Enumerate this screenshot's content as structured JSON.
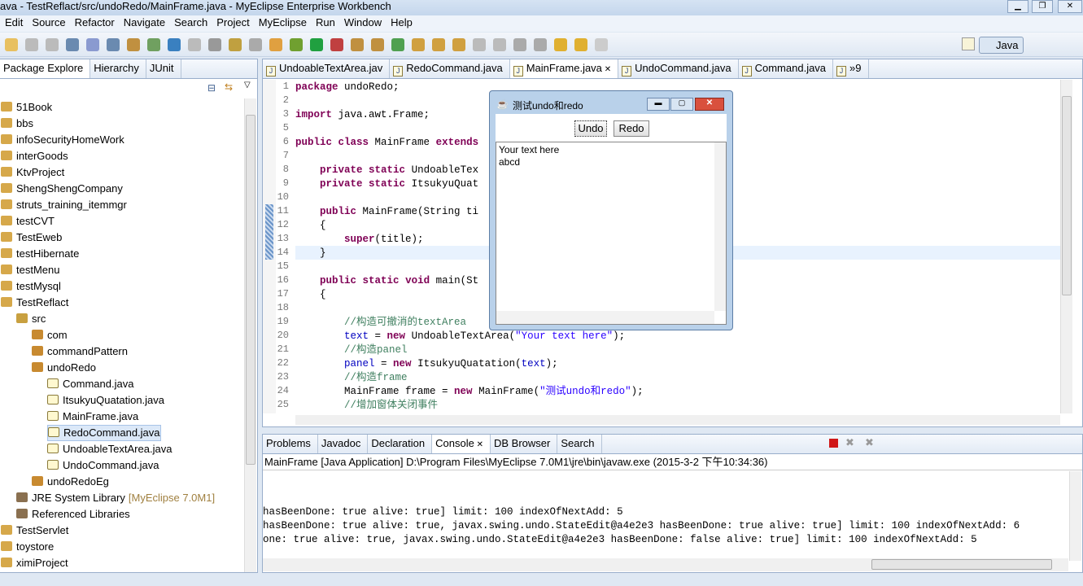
{
  "window": {
    "title": "ava - TestReflact/src/undoRedo/MainFrame.java - MyEclipse Enterprise Workbench"
  },
  "menu": [
    "Edit",
    "Source",
    "Refactor",
    "Navigate",
    "Search",
    "Project",
    "MyEclipse",
    "Run",
    "Window",
    "Help"
  ],
  "perspective": {
    "label": "Java"
  },
  "left_tabs": [
    {
      "label": "Package Explore"
    },
    {
      "label": "Hierarchy"
    },
    {
      "label": "JUnit"
    }
  ],
  "tree": [
    {
      "label": "51Book",
      "level": 0,
      "kind": "project"
    },
    {
      "label": "bbs",
      "level": 0,
      "kind": "project"
    },
    {
      "label": "infoSecurityHomeWork",
      "level": 0,
      "kind": "project"
    },
    {
      "label": "interGoods",
      "level": 0,
      "kind": "project"
    },
    {
      "label": "KtvProject",
      "level": 0,
      "kind": "project"
    },
    {
      "label": "ShengShengCompany",
      "level": 0,
      "kind": "project"
    },
    {
      "label": "struts_training_itemmgr",
      "level": 0,
      "kind": "project"
    },
    {
      "label": "testCVT",
      "level": 0,
      "kind": "project"
    },
    {
      "label": "TestEweb",
      "level": 0,
      "kind": "project"
    },
    {
      "label": "testHibernate",
      "level": 0,
      "kind": "project"
    },
    {
      "label": "testMenu",
      "level": 0,
      "kind": "project"
    },
    {
      "label": "testMysql",
      "level": 0,
      "kind": "project"
    },
    {
      "label": "TestReflact",
      "level": 0,
      "kind": "project"
    },
    {
      "label": "src",
      "level": 1,
      "kind": "folder"
    },
    {
      "label": "com",
      "level": 2,
      "kind": "package"
    },
    {
      "label": "commandPattern",
      "level": 2,
      "kind": "package"
    },
    {
      "label": "undoRedo",
      "level": 2,
      "kind": "package"
    },
    {
      "label": "Command.java",
      "level": 3,
      "kind": "file"
    },
    {
      "label": "ItsukyuQuatation.java",
      "level": 3,
      "kind": "file"
    },
    {
      "label": "MainFrame.java",
      "level": 3,
      "kind": "file"
    },
    {
      "label": "RedoCommand.java",
      "level": 3,
      "kind": "file",
      "selected": true
    },
    {
      "label": "UndoableTextArea.java",
      "level": 3,
      "kind": "file"
    },
    {
      "label": "UndoCommand.java",
      "level": 3,
      "kind": "file"
    },
    {
      "label": "undoRedoEg",
      "level": 2,
      "kind": "package"
    },
    {
      "label": "JRE System Library",
      "suffix": "[MyEclipse 7.0M1]",
      "level": 1,
      "kind": "library"
    },
    {
      "label": "Referenced Libraries",
      "level": 1,
      "kind": "library"
    },
    {
      "label": "TestServlet",
      "level": 0,
      "kind": "project"
    },
    {
      "label": "toystore",
      "level": 0,
      "kind": "project"
    },
    {
      "label": "ximiProject",
      "level": 0,
      "kind": "project"
    }
  ],
  "editor_tabs": [
    {
      "label": "UndoableTextArea.jav"
    },
    {
      "label": "RedoCommand.java"
    },
    {
      "label": "MainFrame.java",
      "active": true
    },
    {
      "label": "UndoCommand.java"
    },
    {
      "label": "Command.java"
    },
    {
      "label": "»9"
    }
  ],
  "code": [
    {
      "n": "1",
      "t": "package undoRedo;"
    },
    {
      "n": "2",
      "t": ""
    },
    {
      "n": "3",
      "t": "import java.awt.Frame;"
    },
    {
      "n": "5",
      "t": ""
    },
    {
      "n": "6",
      "t": "public class MainFrame extends"
    },
    {
      "n": "7",
      "t": ""
    },
    {
      "n": "8",
      "t": "    private static UndoableTex"
    },
    {
      "n": "9",
      "t": "    private static ItsukyuQuat"
    },
    {
      "n": "10",
      "t": ""
    },
    {
      "n": "11",
      "t": "    public MainFrame(String ti"
    },
    {
      "n": "12",
      "t": "    {"
    },
    {
      "n": "13",
      "t": "        super(title);"
    },
    {
      "n": "14",
      "t": "    }"
    },
    {
      "n": "15",
      "t": ""
    },
    {
      "n": "16",
      "t": "    public static void main(St"
    },
    {
      "n": "17",
      "t": "    {"
    },
    {
      "n": "18",
      "t": ""
    },
    {
      "n": "19",
      "t": "        //构造可撤消的textArea"
    },
    {
      "n": "20",
      "t": "        text = new UndoableTextArea(\"Your text here\");"
    },
    {
      "n": "21",
      "t": "        //构造panel"
    },
    {
      "n": "22",
      "t": "        panel = new ItsukyuQuatation(text);"
    },
    {
      "n": "23",
      "t": "        //构造frame"
    },
    {
      "n": "24",
      "t": "        MainFrame frame = new MainFrame(\"测试undo和redo\");"
    },
    {
      "n": "25",
      "t": "        //增加窗体关闭事件"
    }
  ],
  "dialog": {
    "title": "测试undo和redo",
    "undo": "Undo",
    "redo": "Redo",
    "text": "Your text here\nabcd"
  },
  "bottom_tabs": [
    {
      "label": "Problems"
    },
    {
      "label": "Javadoc"
    },
    {
      "label": "Declaration"
    },
    {
      "label": "Console",
      "active": true
    },
    {
      "label": "DB Browser"
    },
    {
      "label": "Search"
    }
  ],
  "console": {
    "header": "MainFrame [Java Application] D:\\Program Files\\MyEclipse 7.0M1\\jre\\bin\\javaw.exe (2015-3-2 下午10:34:36)",
    "lines": [
      "hasBeenDone: true alive: true] limit: 100 indexOfNextAdd: 5",
      "hasBeenDone: true alive: true, javax.swing.undo.StateEdit@a4e2e3 hasBeenDone: true alive: true] limit: 100 indexOfNextAdd: 6",
      "one: true alive: true, javax.swing.undo.StateEdit@a4e2e3 hasBeenDone: false alive: true] limit: 100 indexOfNextAdd: 5"
    ]
  }
}
